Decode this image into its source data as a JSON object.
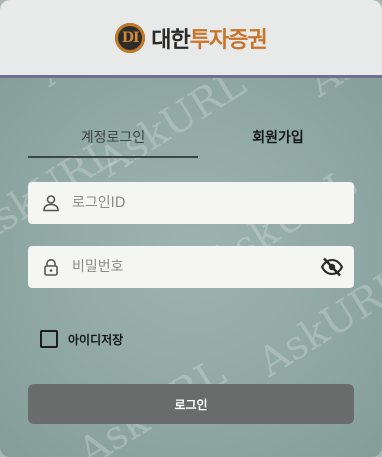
{
  "brand": {
    "logo_mark": "DI",
    "name_part1": "대한",
    "name_part2": "투자증권"
  },
  "watermark": "AskURL",
  "tabs": [
    {
      "label": "계정로그인",
      "active": true
    },
    {
      "label": "회원가입",
      "active": false
    }
  ],
  "form": {
    "id_placeholder": "로그인ID",
    "id_value": "",
    "password_placeholder": "비밀번호",
    "password_value": "",
    "remember_label": "아이디저장",
    "remember_checked": false,
    "submit_label": "로그인"
  },
  "icons": {
    "user": "user-icon",
    "lock": "lock-icon",
    "eye": "eye-slash-icon"
  },
  "colors": {
    "header_bg": "#e8eaea",
    "header_border": "#6f6f96",
    "accent": "#c9742b",
    "button_bg": "#6a6c6b"
  }
}
